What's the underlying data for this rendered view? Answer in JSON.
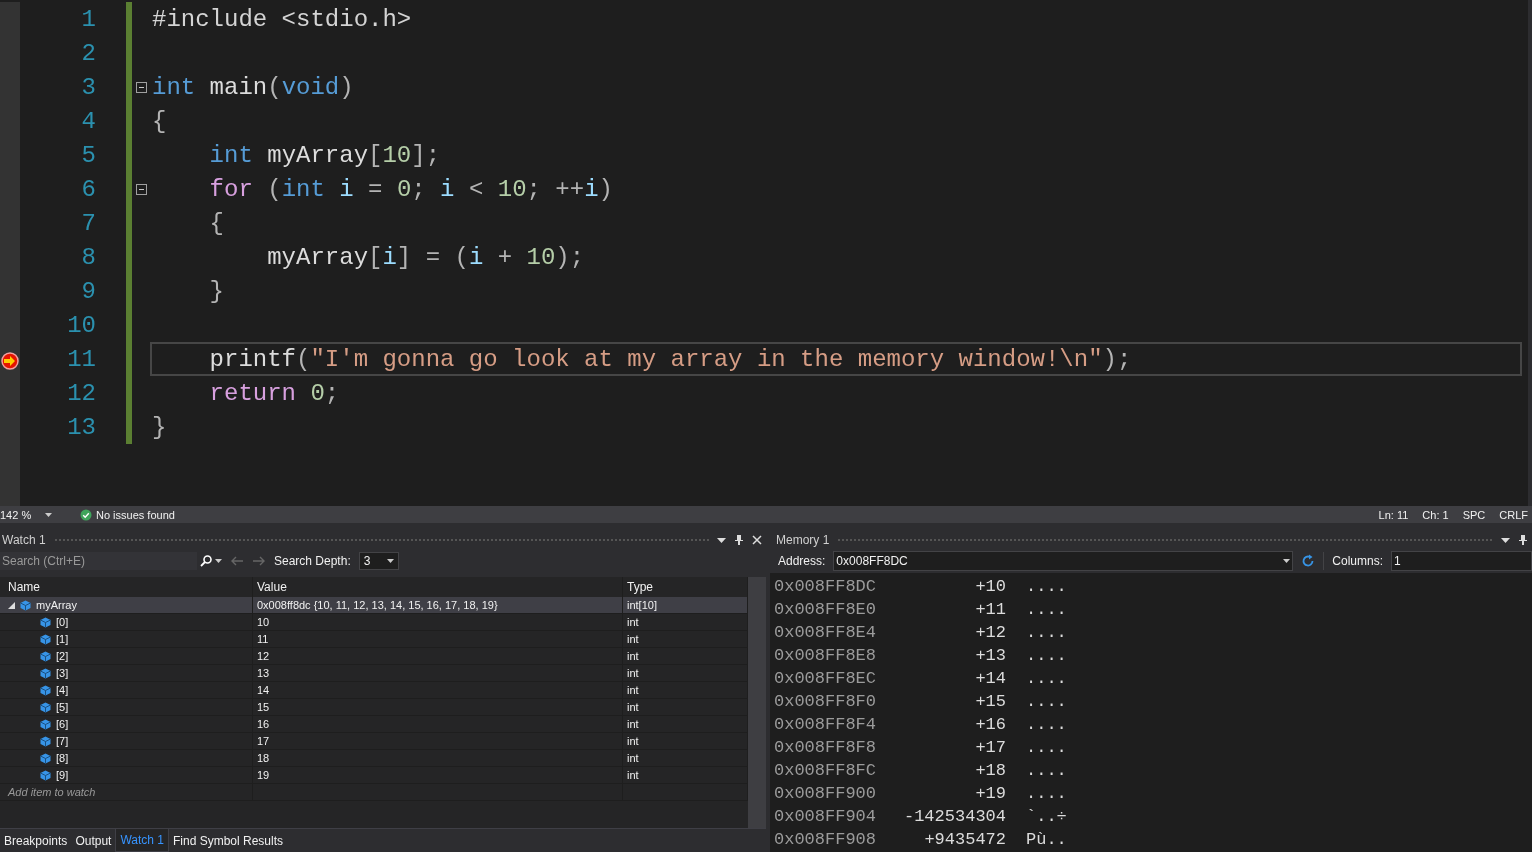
{
  "editor": {
    "lines": [
      {
        "number": "1",
        "current": false,
        "fold_toggle": false,
        "tokens": [
          {
            "text": "#include <stdio.h>",
            "kind": "preprocessor"
          }
        ]
      },
      {
        "number": "2",
        "current": false,
        "fold_toggle": false
      },
      {
        "number": "3",
        "current": false,
        "fold_toggle": true,
        "tokens": [
          {
            "text": "int",
            "kind": "keyword"
          },
          {
            "text": " main",
            "kind": "identifier"
          },
          {
            "text": "(",
            "kind": "punct"
          },
          {
            "text": "void",
            "kind": "keyword"
          },
          {
            "text": ")",
            "kind": "punct"
          }
        ]
      },
      {
        "number": "4",
        "current": false,
        "fold_toggle": false,
        "tokens": [
          {
            "text": "{",
            "kind": "punct"
          }
        ]
      },
      {
        "number": "5",
        "current": false,
        "fold_toggle": false,
        "tokens": [
          {
            "text": "    int",
            "kind": "keyword"
          },
          {
            "text": " myArray",
            "kind": "identifier"
          },
          {
            "text": "[",
            "kind": "punct"
          },
          {
            "text": "10",
            "kind": "number"
          },
          {
            "text": "];",
            "kind": "punct"
          }
        ]
      },
      {
        "number": "6",
        "current": false,
        "fold_toggle": true,
        "tokens": [
          {
            "text": "    for",
            "kind": "control"
          },
          {
            "text": " (",
            "kind": "punct"
          },
          {
            "text": "int",
            "kind": "keyword"
          },
          {
            "text": " i",
            "kind": "variable"
          },
          {
            "text": " = ",
            "kind": "punct"
          },
          {
            "text": "0",
            "kind": "number"
          },
          {
            "text": "; ",
            "kind": "punct"
          },
          {
            "text": "i",
            "kind": "variable"
          },
          {
            "text": " < ",
            "kind": "punct"
          },
          {
            "text": "10",
            "kind": "number"
          },
          {
            "text": "; ++",
            "kind": "punct"
          },
          {
            "text": "i",
            "kind": "variable"
          },
          {
            "text": ")",
            "kind": "punct"
          }
        ]
      },
      {
        "number": "7",
        "current": false,
        "fold_toggle": false,
        "tokens": [
          {
            "text": "    {",
            "kind": "punct"
          }
        ]
      },
      {
        "number": "8",
        "current": false,
        "fold_toggle": false,
        "tokens": [
          {
            "text": "        myArray",
            "kind": "identifier"
          },
          {
            "text": "[",
            "kind": "punct"
          },
          {
            "text": "i",
            "kind": "variable"
          },
          {
            "text": "] = (",
            "kind": "punct"
          },
          {
            "text": "i",
            "kind": "variable"
          },
          {
            "text": " + ",
            "kind": "punct"
          },
          {
            "text": "10",
            "kind": "number"
          },
          {
            "text": ");",
            "kind": "punct"
          }
        ]
      },
      {
        "number": "9",
        "current": false,
        "fold_toggle": false,
        "tokens": [
          {
            "text": "    }",
            "kind": "punct"
          }
        ]
      },
      {
        "number": "10",
        "current": false,
        "fold_toggle": false
      },
      {
        "number": "11",
        "current": true,
        "fold_toggle": false,
        "tokens": [
          {
            "text": "    printf",
            "kind": "identifier"
          },
          {
            "text": "(",
            "kind": "punct"
          },
          {
            "text": "\"I'm gonna go look at my array in the memory window!\\n\"",
            "kind": "string"
          },
          {
            "text": ");",
            "kind": "punct"
          }
        ]
      },
      {
        "number": "12",
        "current": false,
        "fold_toggle": false,
        "tokens": [
          {
            "text": "    return ",
            "kind": "control"
          },
          {
            "text": "0",
            "kind": "number"
          },
          {
            "text": ";",
            "kind": "punct"
          }
        ]
      },
      {
        "number": "13",
        "current": false,
        "fold_toggle": false,
        "tokens": [
          {
            "text": "}",
            "kind": "punct"
          }
        ]
      }
    ]
  },
  "status_bar": {
    "zoom": "142 %",
    "issues": "No issues found",
    "line": "Ln: 11",
    "column": "Ch: 1",
    "indent": "SPC",
    "line_ending": "CRLF"
  },
  "watch": {
    "title": "Watch 1",
    "search": {
      "placeholder": "Search (Ctrl+E)"
    },
    "search_depth_label": "Search Depth:",
    "search_depth": "3",
    "columns": [
      "Name",
      "Value",
      "Type"
    ],
    "items": [
      {
        "name": "myArray",
        "value": "0x008ff8dc {10, 11, 12, 13, 14, 15, 16, 17, 18, 19}",
        "type": "int[10]",
        "expanded": true,
        "selected": true,
        "children": [
          {
            "name": "[0]",
            "value": "10",
            "type": "int",
            "selected": false
          },
          {
            "name": "[1]",
            "value": "11",
            "type": "int",
            "selected": false
          },
          {
            "name": "[2]",
            "value": "12",
            "type": "int",
            "selected": false
          },
          {
            "name": "[3]",
            "value": "13",
            "type": "int",
            "selected": false
          },
          {
            "name": "[4]",
            "value": "14",
            "type": "int",
            "selected": false
          },
          {
            "name": "[5]",
            "value": "15",
            "type": "int",
            "selected": false
          },
          {
            "name": "[6]",
            "value": "16",
            "type": "int",
            "selected": false
          },
          {
            "name": "[7]",
            "value": "17",
            "type": "int",
            "selected": false
          },
          {
            "name": "[8]",
            "value": "18",
            "type": "int",
            "selected": false
          },
          {
            "name": "[9]",
            "value": "19",
            "type": "int",
            "selected": false
          }
        ]
      }
    ],
    "add_placeholder": "Add item to watch"
  },
  "memory": {
    "title": "Memory 1",
    "address_label": "Address:",
    "address": "0x008FF8DC",
    "columns_label": "Columns:",
    "columns": "1",
    "rows": [
      {
        "address": "0x008FF8DC",
        "value": "+10",
        "chars": "...."
      },
      {
        "address": "0x008FF8E0",
        "value": "+11",
        "chars": "...."
      },
      {
        "address": "0x008FF8E4",
        "value": "+12",
        "chars": "...."
      },
      {
        "address": "0x008FF8E8",
        "value": "+13",
        "chars": "...."
      },
      {
        "address": "0x008FF8EC",
        "value": "+14",
        "chars": "...."
      },
      {
        "address": "0x008FF8F0",
        "value": "+15",
        "chars": "...."
      },
      {
        "address": "0x008FF8F4",
        "value": "+16",
        "chars": "...."
      },
      {
        "address": "0x008FF8F8",
        "value": "+17",
        "chars": "...."
      },
      {
        "address": "0x008FF8FC",
        "value": "+18",
        "chars": "...."
      },
      {
        "address": "0x008FF900",
        "value": "+19",
        "chars": "...."
      },
      {
        "address": "0x008FF904",
        "value": "-142534304",
        "chars": "`..÷"
      },
      {
        "address": "0x008FF908",
        "value": "+9435472",
        "chars": "Pù.."
      }
    ]
  },
  "bottom_tabs": [
    {
      "label": "Breakpoints",
      "selected": false
    },
    {
      "label": "Output",
      "selected": false
    },
    {
      "label": "Watch 1",
      "selected": true
    },
    {
      "label": "Find Symbol Results",
      "selected": false
    }
  ]
}
